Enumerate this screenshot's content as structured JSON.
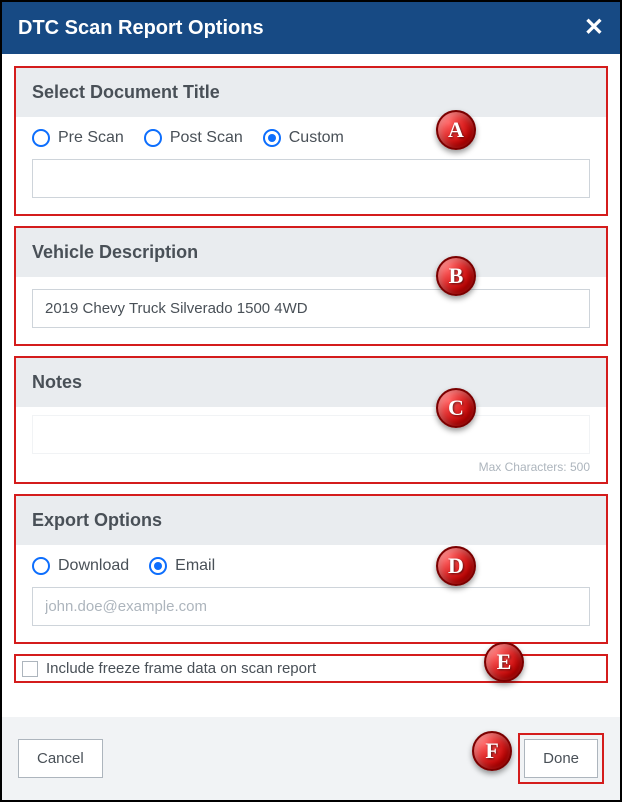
{
  "header": {
    "title": "DTC Scan Report Options"
  },
  "sections": {
    "docTitle": {
      "header": "Select Document Title",
      "options": {
        "pre": "Pre Scan",
        "post": "Post Scan",
        "custom": "Custom"
      },
      "selected": "custom",
      "customValue": ""
    },
    "vehicle": {
      "header": "Vehicle Description",
      "value": "2019 Chevy Truck Silverado 1500 4WD"
    },
    "notes": {
      "header": "Notes",
      "value": "",
      "hint": "Max Characters: 500"
    },
    "export": {
      "header": "Export Options",
      "options": {
        "download": "Download",
        "email": "Email"
      },
      "selected": "email",
      "emailPlaceholder": "john.doe@example.com",
      "emailValue": ""
    },
    "freeze": {
      "label": "Include freeze frame data on scan report",
      "checked": false
    }
  },
  "footer": {
    "cancel": "Cancel",
    "done": "Done"
  },
  "badges": {
    "a": "A",
    "b": "B",
    "c": "C",
    "d": "D",
    "e": "E",
    "f": "F"
  }
}
